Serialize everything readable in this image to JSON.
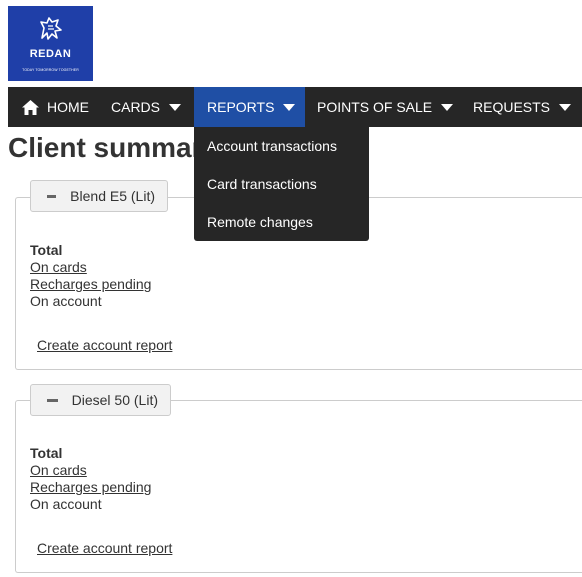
{
  "logo": {
    "name": "REDAN",
    "tagline": "TODAY TOMORROW TOGETHER"
  },
  "nav": {
    "home": "HOME",
    "cards": "CARDS",
    "reports": "REPORTS",
    "points_of_sale": "POINTS OF SALE",
    "requests": "REQUESTS"
  },
  "reports_menu": [
    "Account transactions",
    "Card transactions",
    "Remote changes"
  ],
  "page_title": "Client summary",
  "panels": [
    {
      "legend": "Blend E5 (Lit)",
      "total": "Total",
      "on_cards": "On cards",
      "recharges_pending": "Recharges pending",
      "on_account": "On account",
      "create_report": "Create account report"
    },
    {
      "legend": "Diesel 50 (Lit)",
      "total": "Total",
      "on_cards": "On cards",
      "recharges_pending": "Recharges pending",
      "on_account": "On account",
      "create_report": "Create account report"
    }
  ]
}
